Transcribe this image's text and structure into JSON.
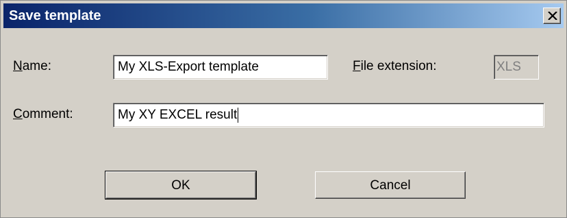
{
  "dialog": {
    "title": "Save template",
    "close_icon": "close-icon"
  },
  "form": {
    "name_label_mnemonic": "N",
    "name_label_rest": "ame:",
    "name_value": "My XLS-Export template",
    "extension_label_mnemonic": "F",
    "extension_label_rest": "ile extension:",
    "extension_value": "XLS",
    "comment_label_mnemonic": "C",
    "comment_label_rest": "omment:",
    "comment_value": "My XY EXCEL result"
  },
  "buttons": {
    "ok_label": "OK",
    "cancel_label": "Cancel"
  }
}
